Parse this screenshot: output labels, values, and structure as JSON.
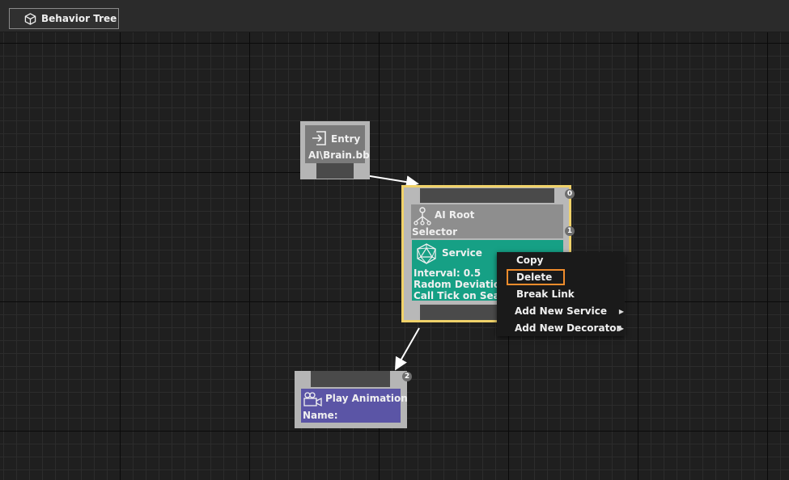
{
  "tab": {
    "label": "Behavior Tree",
    "icon": "cube-icon"
  },
  "entry_node": {
    "title": "Entry",
    "subtitle": "AI\\Brain.bb",
    "icon": "entry-icon"
  },
  "root_node": {
    "title": "AI Root",
    "subtitle": "Selector",
    "icon": "hierarchy-icon",
    "badge_top": "0",
    "badge_mid": "1",
    "highlight_color": "#f0d26a"
  },
  "service": {
    "title": "Service",
    "icon": "icosahedron-icon",
    "line1": "Interval: 0.5",
    "line2": "Radom Deviation:",
    "line3": "Call Tick on Search",
    "color": "#16a085"
  },
  "play_node": {
    "title": "Play Animation",
    "subtitle": "Name:",
    "badge": "2",
    "icon": "camera-icon",
    "color": "#5b55a6"
  },
  "context_menu": {
    "items": [
      {
        "label": "Copy"
      },
      {
        "label": "Delete"
      },
      {
        "label": "Break Link"
      },
      {
        "label": "Add New Service",
        "submenu": true
      },
      {
        "label": "Add New Decorator",
        "submenu": true
      }
    ],
    "highlight_color": "#f08c2c"
  }
}
